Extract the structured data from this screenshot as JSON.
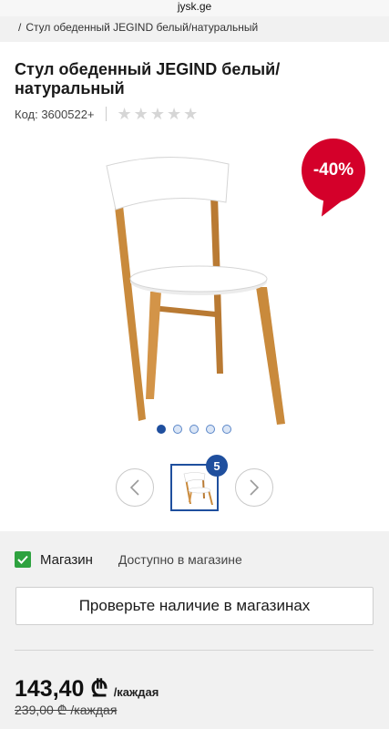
{
  "browser": {
    "url": "jysk.ge"
  },
  "breadcrumb": {
    "separator": "/",
    "current": "Стул обеденный JEGIND белый/натуральный"
  },
  "product": {
    "title": "Стул обеденный JEGIND белый/ натуральный",
    "code": "Код: 3600522+",
    "rating_stars": 5,
    "discount": "-40%",
    "image_icon": "chair-image",
    "gallery_pages": 5,
    "gallery_active": 1,
    "thumbnail_count": "5"
  },
  "stock": {
    "store_label": "Магазин",
    "availability": "Доступно в магазине",
    "check_button": "Проверьте наличие в магазинах"
  },
  "pricing": {
    "price": "143,40 ₾",
    "price_unit": "/каждая",
    "old_price": "239,00 ₾ /каждая"
  },
  "colors": {
    "accent": "#1f4f9e",
    "discount": "#d4002a",
    "in_stock": "#2ea23f"
  }
}
